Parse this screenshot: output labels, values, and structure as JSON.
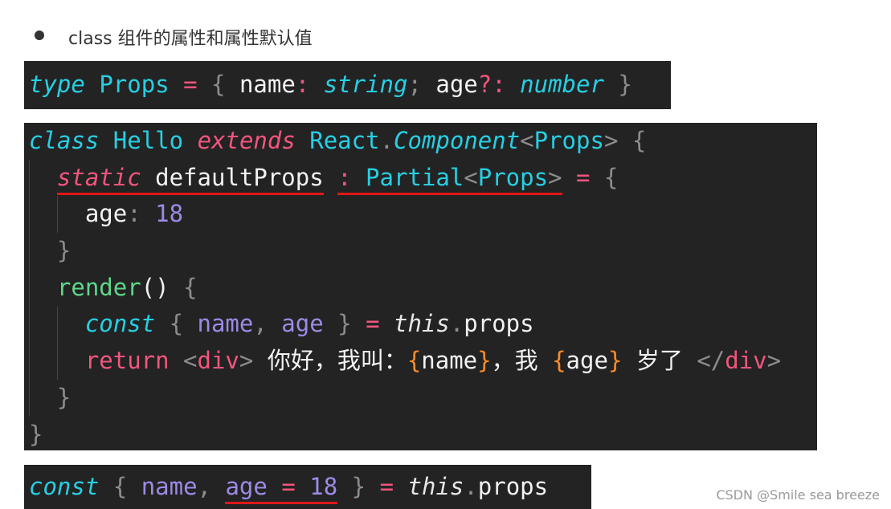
{
  "heading": "class 组件的属性和属性默认值",
  "watermark": "CSDN @Smile sea breeze",
  "colors": {
    "background": "#232323",
    "cyan": "#27cfe3",
    "pink": "#f2557d",
    "purple": "#9d8ae6",
    "green": "#5fd68c",
    "orange": "#ff8a2a",
    "underline": "#e01818"
  },
  "code": {
    "b1": {
      "lines": [
        {
          "indent": 0,
          "tokens": [
            {
              "t": "type",
              "c": "ti"
            },
            {
              "t": " "
            },
            {
              "t": "Props",
              "c": "c"
            },
            {
              "t": " = ",
              "c": "p"
            },
            {
              "t": "{ ",
              "c": "g"
            },
            {
              "t": "name",
              "c": "w"
            },
            {
              "t": ": ",
              "c": "p"
            },
            {
              "t": "string",
              "c": "ti"
            },
            {
              "t": "; ",
              "c": "g"
            },
            {
              "t": "age",
              "c": "w"
            },
            {
              "t": "?: ",
              "c": "p"
            },
            {
              "t": "number",
              "c": "ti"
            },
            {
              "t": " }",
              "c": "g"
            }
          ]
        }
      ]
    },
    "b2": {
      "lines": [
        {
          "indent": 0,
          "tokens": [
            {
              "t": "class",
              "c": "ti"
            },
            {
              "t": " "
            },
            {
              "t": "Hello",
              "c": "c"
            },
            {
              "t": " "
            },
            {
              "t": "extends",
              "c": "pi"
            },
            {
              "t": " "
            },
            {
              "t": "React",
              "c": "c"
            },
            {
              "t": ".",
              "c": "g"
            },
            {
              "t": "Component",
              "c": "ti"
            },
            {
              "t": "<",
              "c": "g"
            },
            {
              "t": "Props",
              "c": "c"
            },
            {
              "t": ">",
              "c": "g"
            },
            {
              "t": " {",
              "c": "g"
            }
          ]
        },
        {
          "indent": 1,
          "tokens": [
            {
              "t": "static",
              "c": "pi",
              "u": true
            },
            {
              "t": " ",
              "u": true
            },
            {
              "t": "defaultProps",
              "c": "w",
              "u": true
            },
            {
              "t": " "
            },
            {
              "t": ": ",
              "c": "p",
              "u": true
            },
            {
              "t": "Partial",
              "c": "c",
              "u": true
            },
            {
              "t": "<",
              "c": "g",
              "u": true
            },
            {
              "t": "Props",
              "c": "c",
              "u": true
            },
            {
              "t": ">",
              "c": "g",
              "u": true
            },
            {
              "t": " = ",
              "c": "p"
            },
            {
              "t": "{",
              "c": "g"
            }
          ]
        },
        {
          "indent": 2,
          "tokens": [
            {
              "t": "age",
              "c": "w"
            },
            {
              "t": ": ",
              "c": "g"
            },
            {
              "t": "18",
              "c": "n"
            }
          ]
        },
        {
          "indent": 1,
          "tokens": [
            {
              "t": "}",
              "c": "g"
            }
          ]
        },
        {
          "indent": 1,
          "tokens": [
            {
              "t": "render",
              "c": "gr"
            },
            {
              "t": "() ",
              "c": "w"
            },
            {
              "t": "{",
              "c": "g"
            }
          ]
        },
        {
          "indent": 2,
          "tokens": [
            {
              "t": "const",
              "c": "ti"
            },
            {
              "t": " { ",
              "c": "g"
            },
            {
              "t": "name",
              "c": "n"
            },
            {
              "t": ", ",
              "c": "g"
            },
            {
              "t": "age",
              "c": "n"
            },
            {
              "t": " } ",
              "c": "g"
            },
            {
              "t": "= ",
              "c": "p"
            },
            {
              "t": "this",
              "c": "wi"
            },
            {
              "t": ".",
              "c": "g"
            },
            {
              "t": "props",
              "c": "w"
            }
          ]
        },
        {
          "indent": 2,
          "tokens": [
            {
              "t": "return",
              "c": "p"
            },
            {
              "t": " <",
              "c": "g"
            },
            {
              "t": "div",
              "c": "p"
            },
            {
              "t": "> ",
              "c": "g"
            },
            {
              "t": "你好，我叫：",
              "c": "w"
            },
            {
              "t": "{",
              "c": "o"
            },
            {
              "t": "name",
              "c": "w"
            },
            {
              "t": "}",
              "c": "o"
            },
            {
              "t": "，我 ",
              "c": "w"
            },
            {
              "t": "{",
              "c": "o"
            },
            {
              "t": "age",
              "c": "w"
            },
            {
              "t": "}",
              "c": "o"
            },
            {
              "t": " 岁了 ",
              "c": "w"
            },
            {
              "t": "</",
              "c": "g"
            },
            {
              "t": "div",
              "c": "p"
            },
            {
              "t": ">",
              "c": "g"
            }
          ]
        },
        {
          "indent": 1,
          "tokens": [
            {
              "t": "}",
              "c": "g"
            }
          ]
        },
        {
          "indent": 0,
          "tokens": [
            {
              "t": "}",
              "c": "g"
            }
          ]
        }
      ]
    },
    "b3": {
      "lines": [
        {
          "indent": 0,
          "tokens": [
            {
              "t": "const",
              "c": "ti"
            },
            {
              "t": " { ",
              "c": "g"
            },
            {
              "t": "name",
              "c": "n"
            },
            {
              "t": ", ",
              "c": "g"
            },
            {
              "t": "age",
              "c": "n",
              "u": true
            },
            {
              "t": " = ",
              "c": "p",
              "u": true
            },
            {
              "t": "18",
              "c": "n",
              "u": true
            },
            {
              "t": " } ",
              "c": "g"
            },
            {
              "t": "= ",
              "c": "p"
            },
            {
              "t": "this",
              "c": "wi"
            },
            {
              "t": ".",
              "c": "g"
            },
            {
              "t": "props",
              "c": "w"
            }
          ]
        }
      ]
    }
  }
}
